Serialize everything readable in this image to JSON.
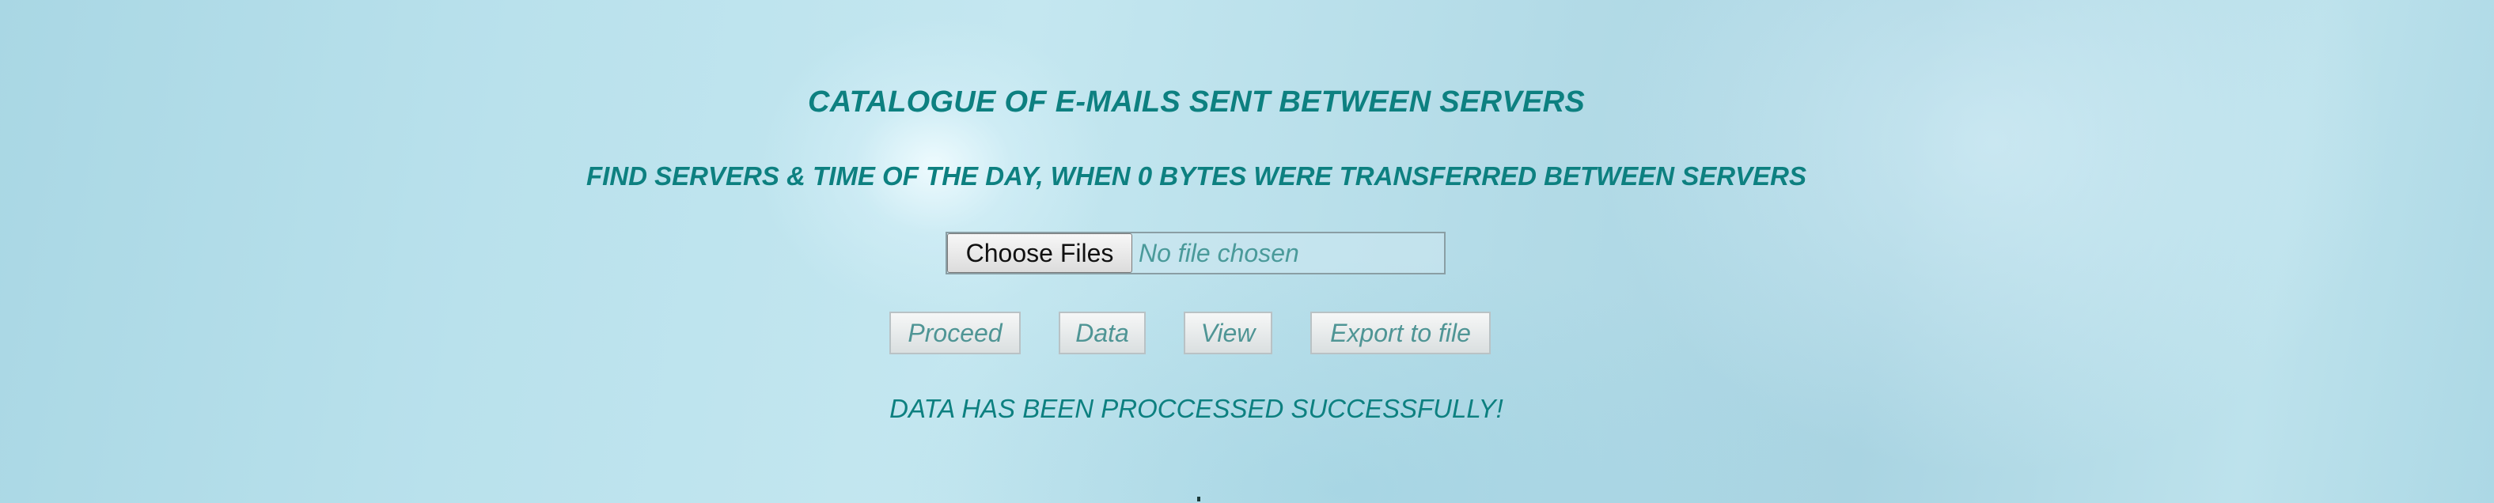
{
  "header": {
    "title": "CATALOGUE OF E-MAILS SENT BETWEEN SERVERS",
    "subtitle": "FIND SERVERS & TIME OF THE DAY, WHEN 0 BYTES WERE TRANSFERRED BETWEEN SERVERS"
  },
  "file_input": {
    "button_label": "Choose Files",
    "status_text": "No file chosen"
  },
  "actions": {
    "proceed_label": "Proceed",
    "data_label": "Data",
    "view_label": "View",
    "export_label": "Export to file"
  },
  "status": {
    "message": "DATA HAS BEEN PROCCESSED SUCCESSFULLY!"
  },
  "colors": {
    "accent_text": "#0d8080",
    "disabled_text": "#4f9595"
  }
}
